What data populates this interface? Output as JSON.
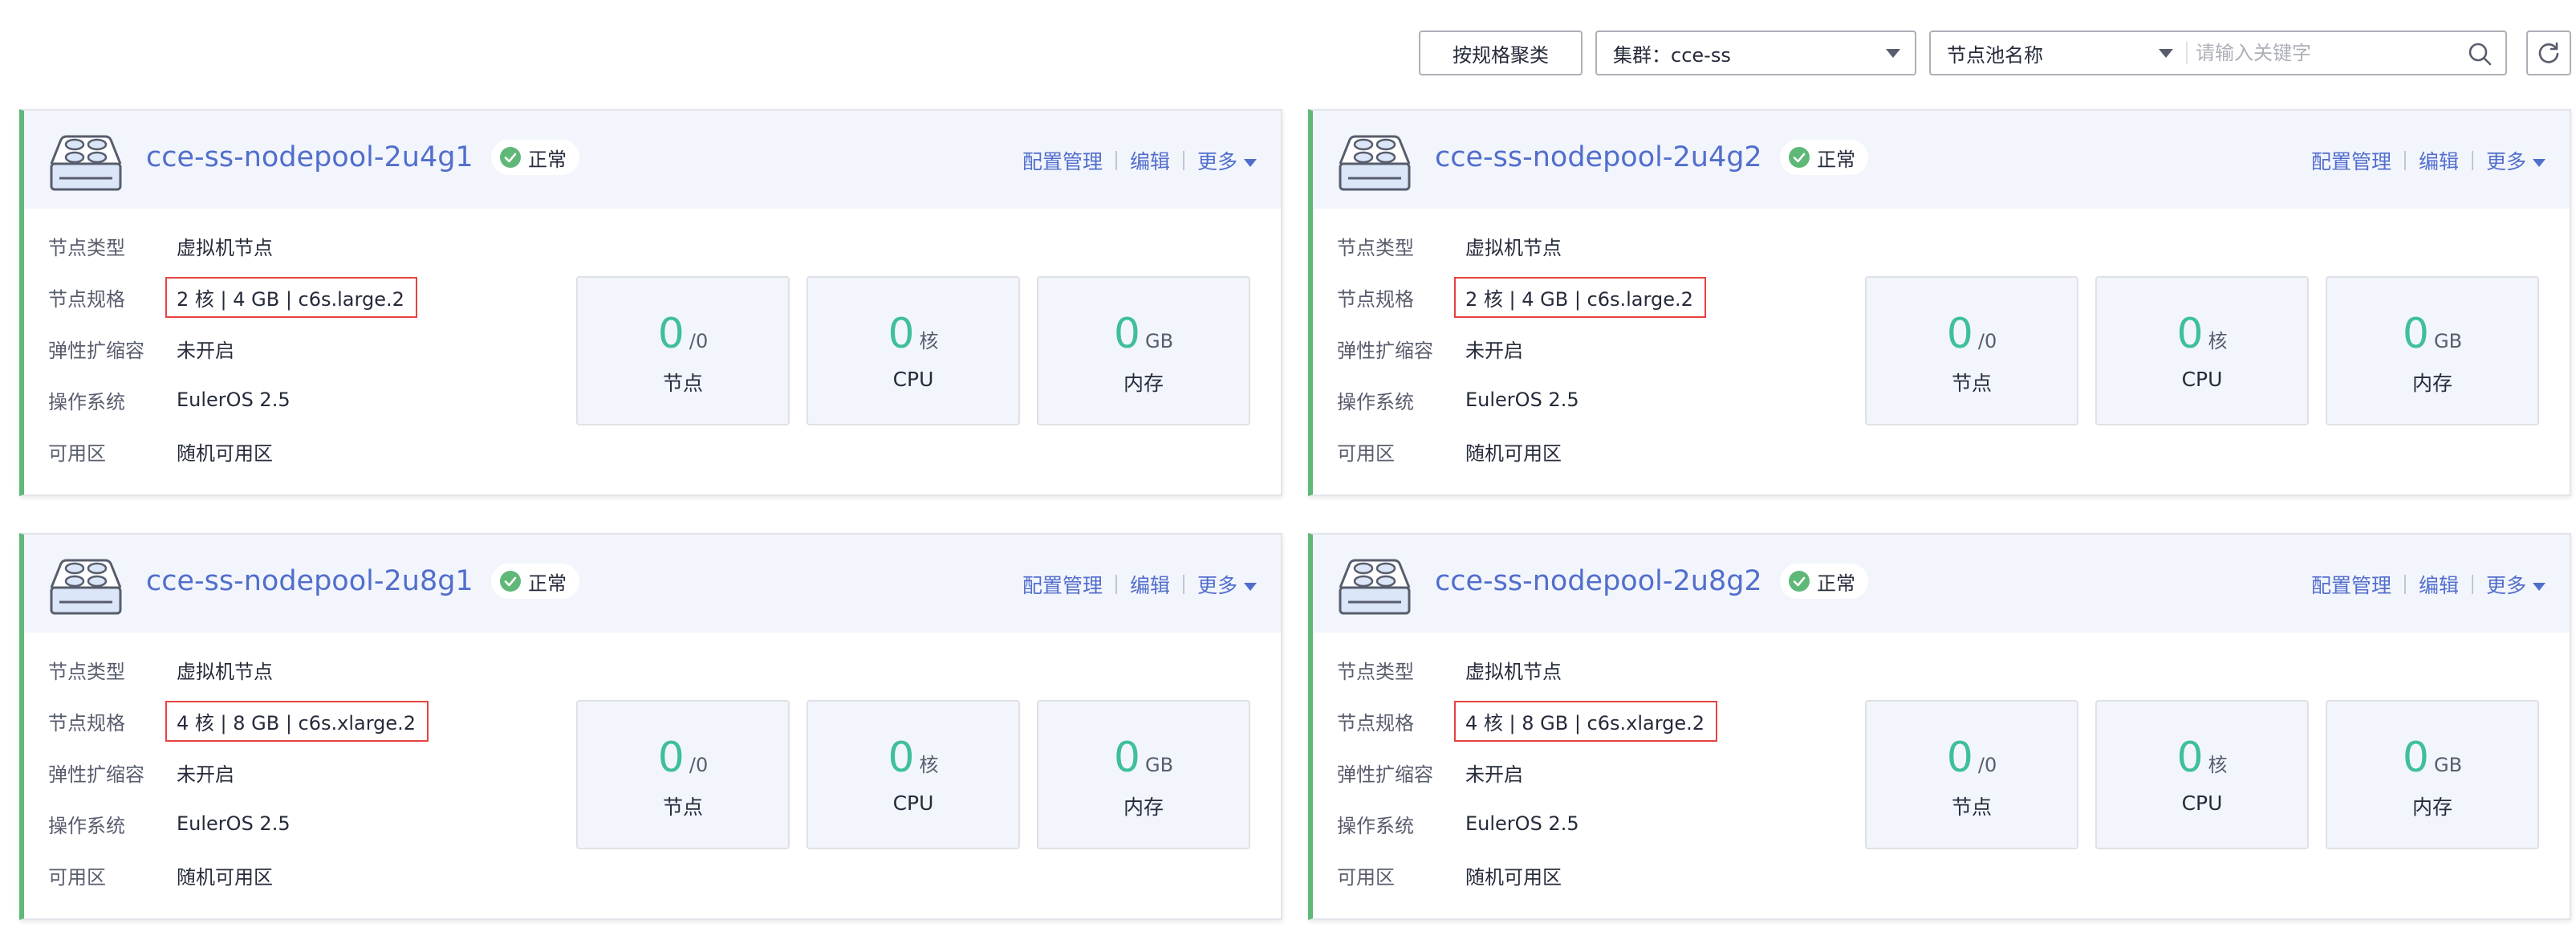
{
  "toolbar": {
    "group_by_spec": "按规格聚类",
    "cluster_select": "集群：cce-ss",
    "filter_field": "节点池名称",
    "search_placeholder": "请输入关键字"
  },
  "labels": {
    "node_type": "节点类型",
    "node_spec": "节点规格",
    "autoscaling": "弹性扩缩容",
    "os": "操作系统",
    "az": "可用区",
    "nodes": "节点",
    "cpu": "CPU",
    "memory": "内存",
    "config_mgmt": "配置管理",
    "edit": "编辑",
    "more": "更多"
  },
  "colors": {
    "accent": "#526ecc",
    "ok": "#5fb878",
    "metric": "#3fbf9b",
    "highlight": "#e64340"
  },
  "nodepools": [
    {
      "name": "cce-ss-nodepool-2u4g1",
      "status": "正常",
      "node_type": "虚拟机节点",
      "spec": "2 核 | 4 GB | c6s.large.2",
      "autoscaling": "未开启",
      "os": "EulerOS 2.5",
      "az": "随机可用区",
      "nodes_value": "0",
      "nodes_unit": "/0",
      "cpu_value": "0",
      "cpu_unit": "核",
      "mem_value": "0",
      "mem_unit": "GB"
    },
    {
      "name": "cce-ss-nodepool-2u4g2",
      "status": "正常",
      "node_type": "虚拟机节点",
      "spec": "2 核 | 4 GB | c6s.large.2",
      "autoscaling": "未开启",
      "os": "EulerOS 2.5",
      "az": "随机可用区",
      "nodes_value": "0",
      "nodes_unit": "/0",
      "cpu_value": "0",
      "cpu_unit": "核",
      "mem_value": "0",
      "mem_unit": "GB"
    },
    {
      "name": "cce-ss-nodepool-2u8g1",
      "status": "正常",
      "node_type": "虚拟机节点",
      "spec": "4 核 | 8 GB | c6s.xlarge.2",
      "autoscaling": "未开启",
      "os": "EulerOS 2.5",
      "az": "随机可用区",
      "nodes_value": "0",
      "nodes_unit": "/0",
      "cpu_value": "0",
      "cpu_unit": "核",
      "mem_value": "0",
      "mem_unit": "GB"
    },
    {
      "name": "cce-ss-nodepool-2u8g2",
      "status": "正常",
      "node_type": "虚拟机节点",
      "spec": "4 核 | 8 GB | c6s.xlarge.2",
      "autoscaling": "未开启",
      "os": "EulerOS 2.5",
      "az": "随机可用区",
      "nodes_value": "0",
      "nodes_unit": "/0",
      "cpu_value": "0",
      "cpu_unit": "核",
      "mem_value": "0",
      "mem_unit": "GB"
    }
  ]
}
